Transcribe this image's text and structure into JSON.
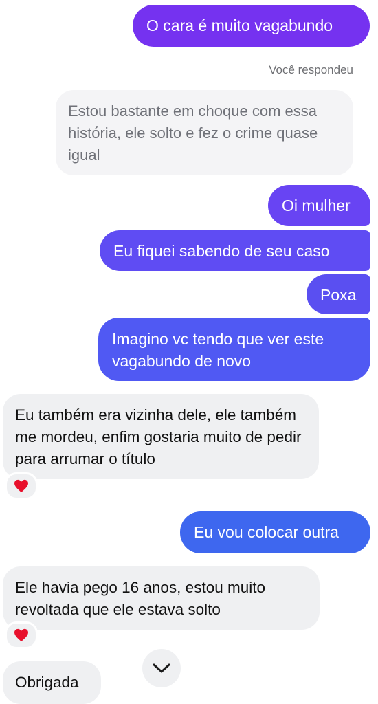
{
  "messages": {
    "out_1": "O cara é muito vagabundo",
    "reply_label": "Você respondeu",
    "quoted_reply": "Estou bastante em choque com essa história, ele solto e fez o crime quase igual",
    "out_2": "Oi mulher",
    "out_3": "Eu fiquei sabendo de seu caso",
    "out_4": "Poxa",
    "out_5": "Imagino vc tendo que ver este vagabundo de novo",
    "in_1": "Eu também era vizinha dele, ele também me mordeu, enfim gostaria muito de pedir para arrumar o título",
    "out_6": "Eu vou colocar outra",
    "in_2": "Ele havia pego 16 anos, estou muito revoltada que ele estava solto",
    "in_3": "Obrigada"
  },
  "reactions": {
    "in_1": "heart-icon",
    "in_2": "heart-icon"
  },
  "icons": {
    "scroll_down": "chevron-down-icon"
  },
  "colors": {
    "out_1": "#7532f0",
    "out_2": "#6844f3",
    "out_3": "#5f4cf3",
    "out_4": "#5a4ff1",
    "out_5": "#5059f3",
    "out_6": "#3e67ef",
    "incoming_bubble": "#eff0f2",
    "reaction_heart": "#e8102c"
  }
}
